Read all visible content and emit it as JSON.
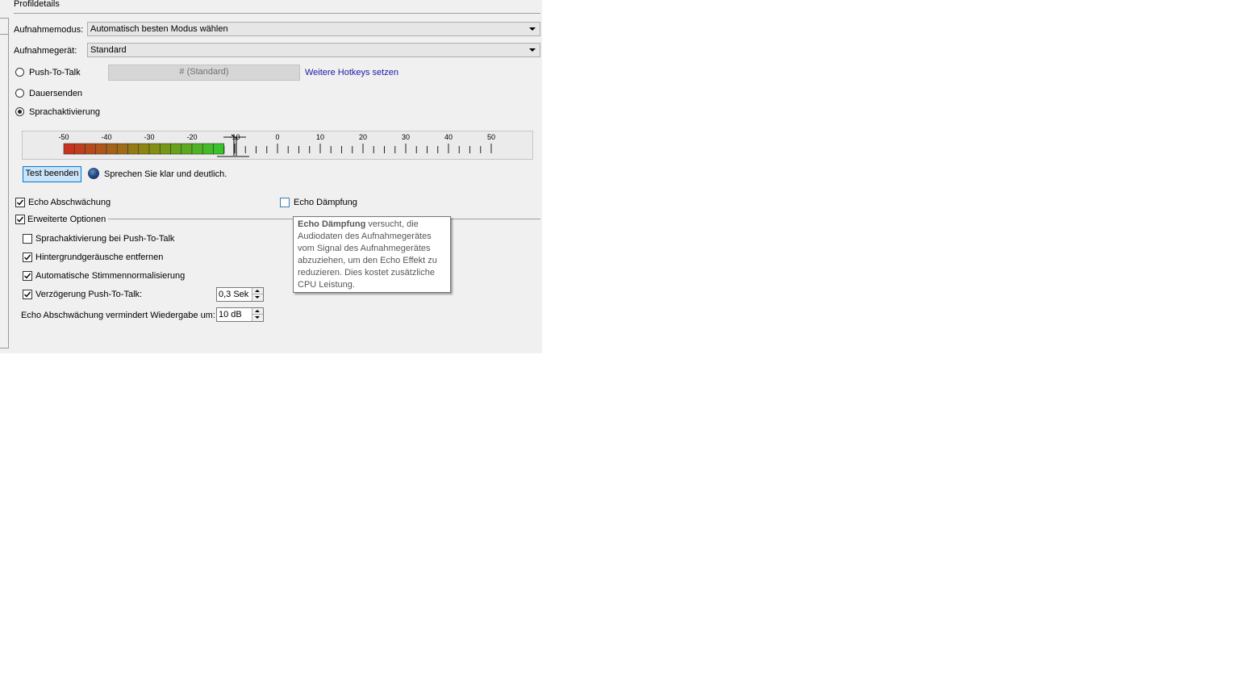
{
  "section_title": "Profildetails",
  "capture_mode": {
    "label": "Aufnahmemodus:",
    "value": "Automatisch besten Modus wählen"
  },
  "capture_device": {
    "label": "Aufnahmegerät:",
    "value": "Standard"
  },
  "modes": {
    "ptt_label": "Push-To-Talk",
    "hotkey_value": "# (Standard)",
    "hotkeys_link": "Weitere Hotkeys setzen",
    "continuous_label": "Dauersenden",
    "voice_label": "Sprachaktivierung",
    "selected": "Sprachaktivierung"
  },
  "meter": {
    "scale_labels": [
      "-50",
      "-40",
      "-30",
      "-20",
      "-10",
      "0",
      "10",
      "20",
      "30",
      "40",
      "50"
    ],
    "scale_min": -50,
    "scale_max": 50,
    "level_db": -13,
    "threshold_db": -10,
    "color_low": "#2ecc2e",
    "color_mid": "#8a8a10",
    "color_high": "#c8321e"
  },
  "test": {
    "button_label": "Test beenden",
    "status_text": "Sprechen Sie klar und deutlich."
  },
  "echo_reduction": {
    "label": "Echo Abschwächung",
    "checked": true
  },
  "echo_cancellation": {
    "label": "Echo Dämpfung",
    "checked": false
  },
  "advanced": {
    "label": "Erweiterte Optionen",
    "checked": true,
    "voice_on_ptt": {
      "label": "Sprachaktivierung bei Push-To-Talk",
      "checked": false
    },
    "remove_noise": {
      "label": "Hintergrundgeräusche entfernen",
      "checked": true
    },
    "auto_normalize": {
      "label": "Automatische Stimmennormalisierung",
      "checked": true
    },
    "ptt_delay": {
      "label": "Verzögerung Push-To-Talk:",
      "checked": true,
      "value": "0,3 Sek"
    },
    "echo_playback": {
      "label": "Echo Abschwächung vermindert Wiedergabe um:",
      "value": "10 dB"
    }
  },
  "tooltip": {
    "bold": "Echo Dämpfung",
    "text": " versucht, die Audiodaten des Aufnahmegerätes vom Signal des Aufnahmegerätes abzuziehen, um den Echo Effekt zu reduzieren. Dies kostet zusätzliche CPU Leistung."
  }
}
